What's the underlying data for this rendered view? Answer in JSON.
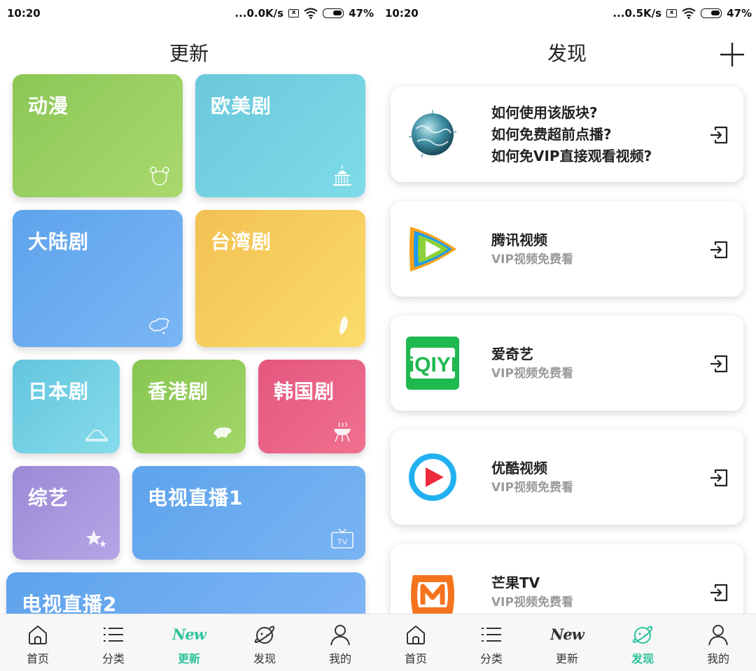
{
  "left_screen": {
    "status": {
      "time": "10:20",
      "net_speed": "...0.0K/s",
      "battery": "47%"
    },
    "title": "更新",
    "tiles": [
      {
        "label": "动漫",
        "icon": "bear-icon"
      },
      {
        "label": "欧美剧",
        "icon": "capitol-icon"
      },
      {
        "label": "大陆剧",
        "icon": "china-map-icon"
      },
      {
        "label": "台湾剧",
        "icon": "taiwan-map-icon"
      },
      {
        "label": "日本剧",
        "icon": "mount-fuji-icon"
      },
      {
        "label": "香港剧",
        "icon": "hongkong-map-icon"
      },
      {
        "label": "韩国剧",
        "icon": "bbq-grill-icon"
      },
      {
        "label": "综艺",
        "icon": "stars-icon"
      },
      {
        "label": "电视直播1",
        "icon": "tv-icon"
      },
      {
        "label": "电视直播2",
        "icon": ""
      }
    ],
    "nav": [
      {
        "label": "首页",
        "icon": "home-icon",
        "active": false
      },
      {
        "label": "分类",
        "icon": "list-icon",
        "active": false
      },
      {
        "label": "更新",
        "icon": "new-icon",
        "icon_text": "New",
        "active": true
      },
      {
        "label": "发现",
        "icon": "planet-icon",
        "active": false
      },
      {
        "label": "我的",
        "icon": "user-icon",
        "active": false
      }
    ]
  },
  "right_screen": {
    "status": {
      "time": "10:20",
      "net_speed": "...0.5K/s",
      "battery": "47%"
    },
    "title": "发现",
    "add_label": "+",
    "help_card": {
      "lines": [
        "如何使用该版块?",
        "如何免费超前点播?",
        "如何免VIP直接观看视频?"
      ],
      "icon": "globe-icon"
    },
    "cards": [
      {
        "title": "腾讯视频",
        "subtitle": "VIP视频免费看",
        "icon": "tencent-video-logo"
      },
      {
        "title": "爱奇艺",
        "subtitle": "VIP视频免费看",
        "icon": "iqiyi-logo",
        "logo_text": "iQIYI"
      },
      {
        "title": "优酷视频",
        "subtitle": "VIP视频免费看",
        "icon": "youku-logo"
      },
      {
        "title": "芒果TV",
        "subtitle": "VIP视频免费看",
        "icon": "mango-tv-logo"
      }
    ],
    "nav": [
      {
        "label": "首页",
        "icon": "home-icon",
        "active": false
      },
      {
        "label": "分类",
        "icon": "list-icon",
        "active": false
      },
      {
        "label": "更新",
        "icon": "new-icon",
        "icon_text": "New",
        "active": false
      },
      {
        "label": "发现",
        "icon": "planet-icon",
        "active": true
      },
      {
        "label": "我的",
        "icon": "user-icon",
        "active": false
      }
    ]
  },
  "colors": {
    "accent": "#2fc39c",
    "nav_bg": "#f7f7f7"
  }
}
